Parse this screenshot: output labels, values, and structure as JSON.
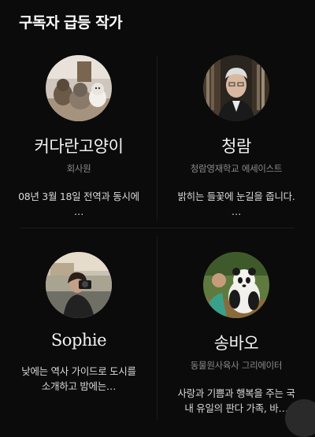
{
  "section": {
    "title": "구독자 급등 작가"
  },
  "authors": [
    {
      "name": "커다란고양이",
      "role": "회사원",
      "desc": "08년 3월 18일 전역과 동시에 …",
      "avatar_icon": "cats-photo"
    },
    {
      "name": "청람",
      "role": "청람영재학교 에세이스트",
      "desc": "밝히는 들꽃에 눈길을 줍니다. …",
      "avatar_icon": "portrait-photo"
    },
    {
      "name": "Sophie",
      "role": "",
      "desc": "낮에는 역사 가이드로 도시를 소개하고 밤에는…",
      "avatar_icon": "photographer-photo"
    },
    {
      "name": "송바오",
      "role": "동물원사육사 그리에이터",
      "desc": "사랑과 기쁨과 행복을 주는 국내 유일의 판다 가족, 바…",
      "avatar_icon": "panda-photo"
    }
  ]
}
